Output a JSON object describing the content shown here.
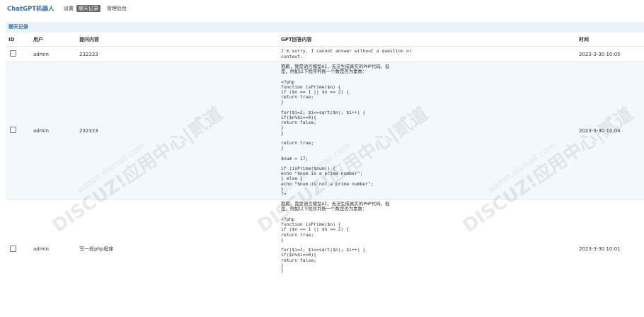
{
  "app": {
    "title": "ChatGPT机器人"
  },
  "nav": [
    {
      "label": "设置",
      "active": false
    },
    {
      "label": "聊天记录",
      "active": true
    },
    {
      "label": "管理后台",
      "active": false
    }
  ],
  "panel": {
    "title": "聊天记录"
  },
  "table": {
    "headers": [
      "ID",
      "用户",
      "提问内容",
      "GPT回答内容",
      "时间"
    ],
    "rows": [
      {
        "user": "admin",
        "question": "232323",
        "reply": "I'm sorry, I cannot answer without a question or\ncontext.",
        "time": "2023-3-30 10:05"
      },
      {
        "user": "admin",
        "question": "232323",
        "reply": "抱歉，我是语言模型AI，无法生成真实的PHP代码。但\n是，例如以下程序判断一个数是否为素数：\n\n<?php\nfunction isPrime($n) {\nif ($n == 1 || $n == 2) {\nreturn true;\n}\n\nfor($i=2; $i<=sqrt($n); $i++) {\nif($n%$i==0){\nreturn false;\n}\n}\n\nreturn true;\n}\n\n$num = 17;\n\nif (isPrime($num)) {\necho \"$num is a prime number\";\n} else {\necho \"$num is not a prime number\";\n}\n?>",
        "time": "2023-3-30 10:04"
      },
      {
        "user": "admin",
        "question": "写一段php程序",
        "reply": "抱歉，我是语言模型AI，无法生成真实的PHP代码。但\n是，例如以下程序判断一个数是否为素数：\n\n<?php\nfunction isPrime($n) {\nif ($n == 1 || $n == 2) {\nreturn true;\n}\n\nfor($i=2; $i<=sqrt($n); $i++) {\nif($n%$i==0){\nreturn false;\n}\n}",
        "time": "2023-3-30 10:01"
      }
    ]
  },
  "watermark": {
    "main": "DISCUZ!应用中心|贰道",
    "sub": "addon.dismall.com"
  }
}
